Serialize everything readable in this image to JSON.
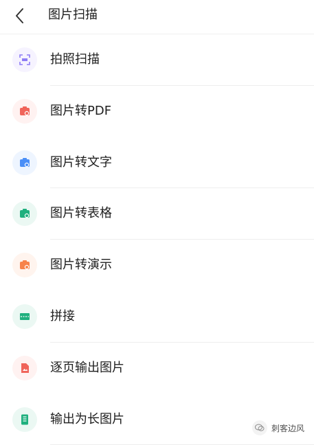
{
  "header": {
    "title": "图片扫描",
    "back_icon": "chevron-left-icon"
  },
  "items": [
    {
      "label": "拍照扫描",
      "icon": "scan-icon",
      "color": "#8e7cf5",
      "bg": "#f6f3ff"
    },
    {
      "label": "图片转PDF",
      "icon": "image-to-pdf-icon",
      "color": "#f0645a",
      "bg": "#fff2f1"
    },
    {
      "label": "图片转文字",
      "icon": "image-to-text-icon",
      "color": "#4b8ff7",
      "bg": "#eef5ff"
    },
    {
      "label": "图片转表格",
      "icon": "image-to-table-icon",
      "color": "#1fb07e",
      "bg": "#ebf8f3"
    },
    {
      "label": "图片转演示",
      "icon": "image-to-slides-icon",
      "color": "#f7834a",
      "bg": "#fff4ee"
    },
    {
      "label": "拼接",
      "icon": "stitch-icon",
      "color": "#1fb07e",
      "bg": "#ebf8f3"
    },
    {
      "label": "逐页输出图片",
      "icon": "export-pages-icon",
      "color": "#f0645a",
      "bg": "#fff2f1"
    },
    {
      "label": "输出为长图片",
      "icon": "long-image-icon",
      "color": "#1fb07e",
      "bg": "#ebf8f3"
    }
  ],
  "watermark": {
    "text": "刺客边风"
  }
}
